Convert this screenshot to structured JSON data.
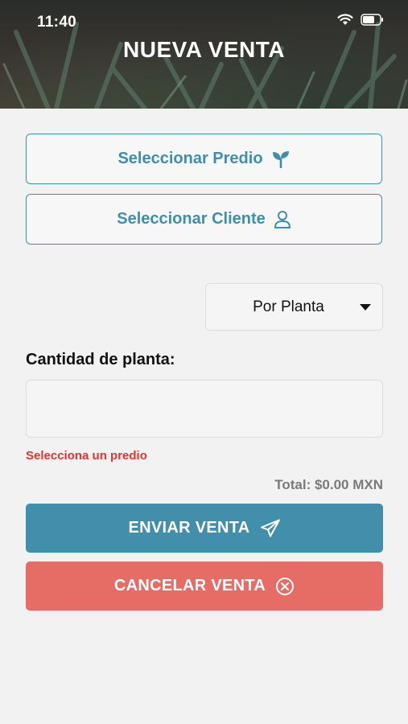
{
  "status_bar": {
    "time": "11:40"
  },
  "header": {
    "title": "NUEVA VENTA"
  },
  "buttons": {
    "select_predio": "Seleccionar Predio",
    "select_cliente": "Seleccionar Cliente",
    "send": "ENVIAR VENTA",
    "cancel": "CANCELAR VENTA"
  },
  "sale_type": {
    "selected": "Por Planta"
  },
  "quantity": {
    "label": "Cantidad de planta:",
    "value": "",
    "placeholder": ""
  },
  "error": "Selecciona un predio",
  "total": "Total: $0.00 MXN",
  "colors": {
    "primary": "#418fab",
    "danger": "#e56d66",
    "error_text": "#e3342f"
  },
  "icons": {
    "predio": "sprout-icon",
    "cliente": "user-icon",
    "send": "paper-plane-icon",
    "cancel": "close-circle-icon"
  }
}
